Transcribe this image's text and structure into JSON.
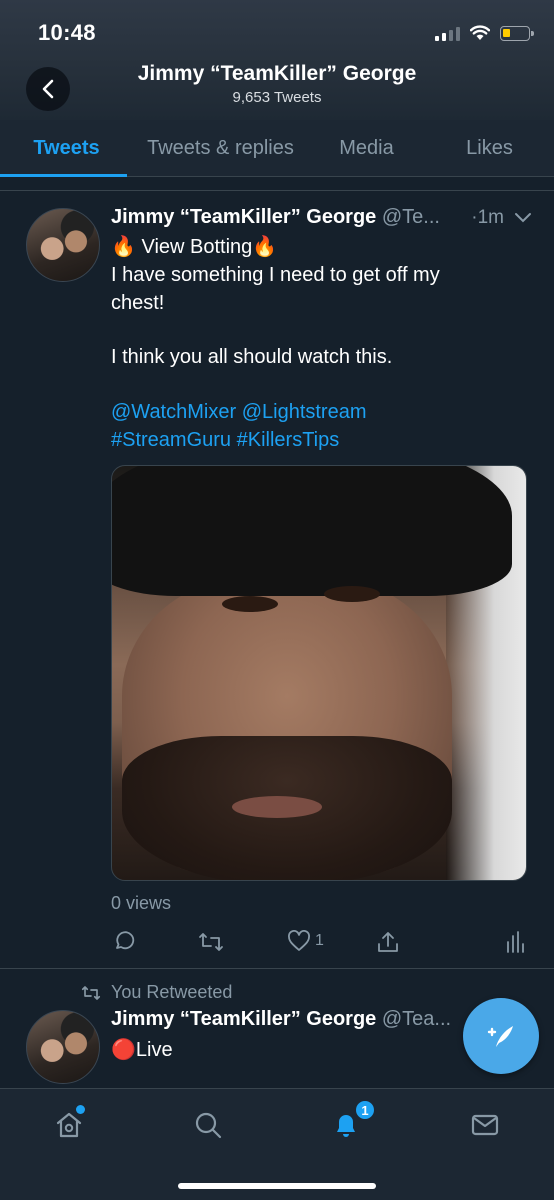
{
  "status_bar": {
    "time": "10:48"
  },
  "header": {
    "title": "Jimmy “TeamKiller” George",
    "subtitle": "9,653 Tweets"
  },
  "tabs": [
    {
      "label": "Tweets",
      "active": true
    },
    {
      "label": "Tweets & replies",
      "active": false
    },
    {
      "label": "Media",
      "active": false
    },
    {
      "label": "Likes",
      "active": false
    }
  ],
  "tweet": {
    "name": "Jimmy “TeamKiller” George",
    "handle": "@Te...",
    "time": "·1m",
    "line1": "🔥 View Botting🔥",
    "line2": "I have something I need to get off my",
    "line3": "chest!",
    "line4": "I think you all should watch this.",
    "mention1": "@WatchMixer",
    "mention2": "@Lightstream",
    "hashtag1": "#StreamGuru",
    "hashtag2": "#KillersTips",
    "views": "0 views",
    "likes": "1"
  },
  "retweet": {
    "label": "You Retweeted",
    "name": "Jimmy “TeamKiller” George",
    "handle": "@Tea...",
    "text": "🔴Live"
  },
  "nav": {
    "notifications_badge": "1"
  },
  "colors": {
    "accent": "#1da1f2",
    "background": "#15202b",
    "muted": "#8899a6"
  }
}
